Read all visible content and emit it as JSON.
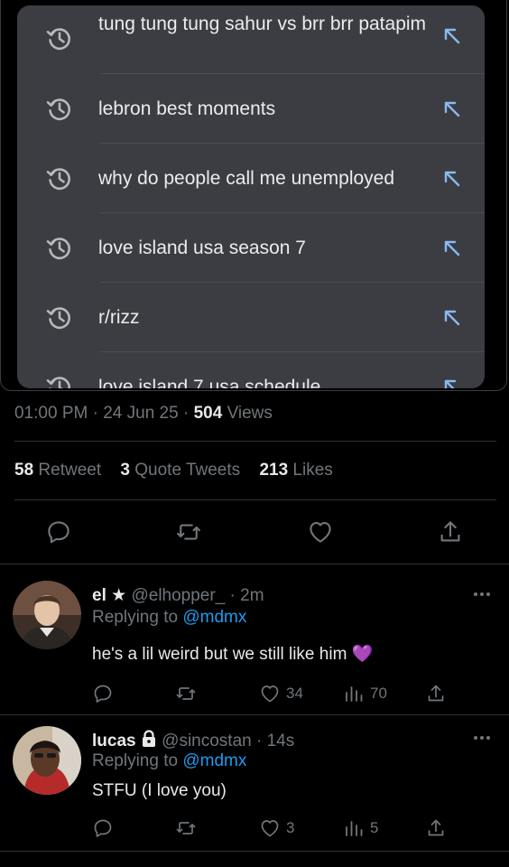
{
  "history": {
    "items": [
      {
        "text": "tung tung tung sahur vs brr brr patapim",
        "icon": "history-clock-icon",
        "action_icon": "arrow-up-left-icon"
      },
      {
        "text": "lebron best moments",
        "icon": "history-clock-icon",
        "action_icon": "arrow-up-left-icon"
      },
      {
        "text": "why do people call me unemployed",
        "icon": "history-clock-icon",
        "action_icon": "arrow-up-left-icon"
      },
      {
        "text": "love island usa season 7",
        "icon": "history-clock-icon",
        "action_icon": "arrow-up-left-icon"
      },
      {
        "text": "r/rizz",
        "icon": "history-clock-icon",
        "action_icon": "arrow-up-left-icon"
      },
      {
        "text": "love island 7 usa schedule",
        "icon": "history-clock-icon",
        "action_icon": "arrow-up-left-icon"
      }
    ]
  },
  "tweet": {
    "time": "01:00 PM",
    "date": "24 Jun 25",
    "views_count": "504",
    "views_label": "Views",
    "retweets_count": "58",
    "retweets_label": "Retweet",
    "quotes_count": "3",
    "quotes_label": "Quote Tweets",
    "likes_count": "213",
    "likes_label": "Likes"
  },
  "replies": [
    {
      "name": "el",
      "badge": "★",
      "handle": "@elhopper_",
      "age": "2m",
      "replying_prefix": "Replying to",
      "replying_to": "@mdmx",
      "text": "he's a lil weird but we still like him 💜",
      "likes": "34",
      "views": "70"
    },
    {
      "name": "lucas",
      "badge": "lock-icon",
      "handle": "@sincostan",
      "age": "14s",
      "replying_prefix": "Replying to",
      "replying_to": "@mdmx",
      "text": "STFU (I love you)",
      "likes": "3",
      "views": "5"
    }
  ],
  "colors": {
    "background": "#000000",
    "panel": "#3b3d42",
    "accent": "#1d9bf0",
    "arrow": "#8ab8f0",
    "muted": "#71767b"
  }
}
